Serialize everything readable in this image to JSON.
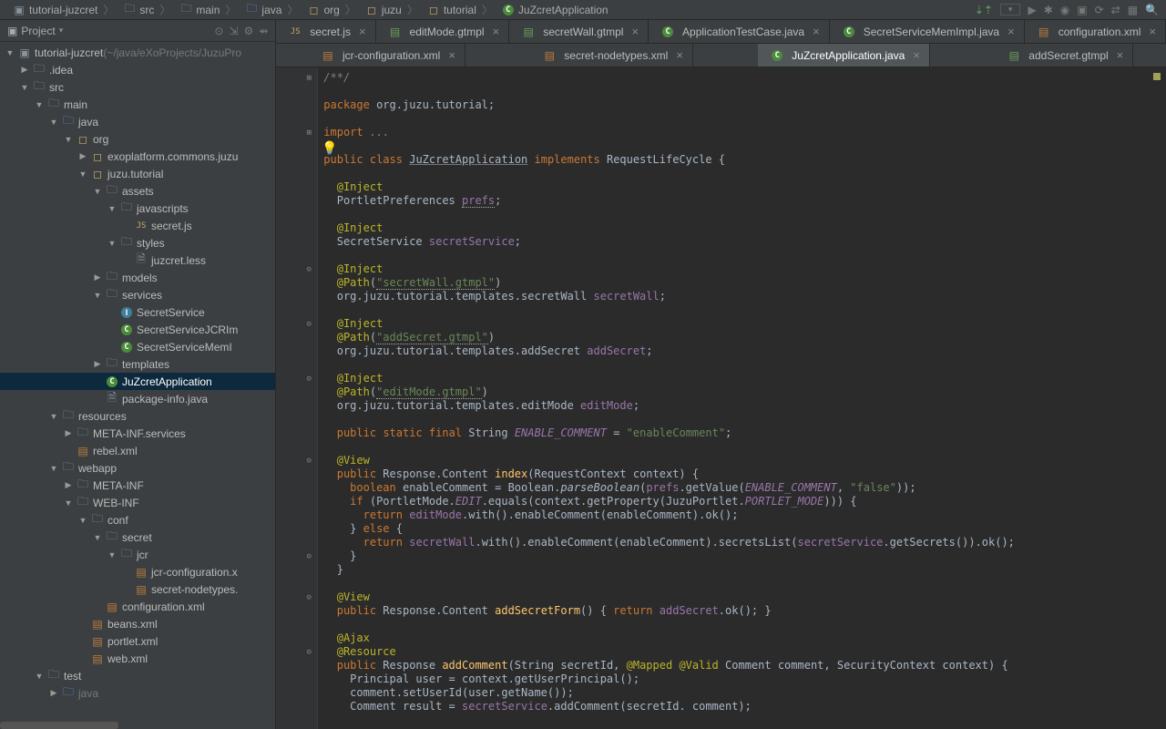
{
  "breadcrumb": {
    "items": [
      {
        "label": "tutorial-juzcret",
        "icon": "module"
      },
      {
        "label": "src",
        "icon": "folder"
      },
      {
        "label": "main",
        "icon": "folder"
      },
      {
        "label": "java",
        "icon": "folder-src"
      },
      {
        "label": "org",
        "icon": "pkg"
      },
      {
        "label": "juzu",
        "icon": "pkg"
      },
      {
        "label": "tutorial",
        "icon": "pkg"
      },
      {
        "label": "JuZcretApplication",
        "icon": "class"
      }
    ]
  },
  "sidebar": {
    "title": "Project",
    "root": {
      "label": "tutorial-juzcret",
      "path": "(~/java/eXoProjects/JuzuPro"
    }
  },
  "tree": [
    {
      "lvl": 0,
      "arrow": "▼",
      "icon": "module",
      "label": "tutorial-juzcret",
      "extra": " (~/java/eXoProjects/JuzuPro"
    },
    {
      "lvl": 1,
      "arrow": "▶",
      "icon": "folder",
      "label": ".idea"
    },
    {
      "lvl": 1,
      "arrow": "▼",
      "icon": "folder",
      "label": "src"
    },
    {
      "lvl": 2,
      "arrow": "▼",
      "icon": "folder",
      "label": "main"
    },
    {
      "lvl": 3,
      "arrow": "▼",
      "icon": "folder-src",
      "label": "java"
    },
    {
      "lvl": 4,
      "arrow": "▼",
      "icon": "pkg",
      "label": "org"
    },
    {
      "lvl": 5,
      "arrow": "▶",
      "icon": "pkg",
      "label": "exoplatform.commons.juzu"
    },
    {
      "lvl": 5,
      "arrow": "▼",
      "icon": "pkg",
      "label": "juzu.tutorial"
    },
    {
      "lvl": 6,
      "arrow": "▼",
      "icon": "folder",
      "label": "assets"
    },
    {
      "lvl": 7,
      "arrow": "▼",
      "icon": "folder",
      "label": "javascripts"
    },
    {
      "lvl": 8,
      "arrow": "",
      "icon": "js",
      "label": "secret.js"
    },
    {
      "lvl": 7,
      "arrow": "▼",
      "icon": "folder",
      "label": "styles"
    },
    {
      "lvl": 8,
      "arrow": "",
      "icon": "file",
      "label": "juzcret.less"
    },
    {
      "lvl": 6,
      "arrow": "▶",
      "icon": "folder",
      "label": "models"
    },
    {
      "lvl": 6,
      "arrow": "▼",
      "icon": "folder",
      "label": "services"
    },
    {
      "lvl": 7,
      "arrow": "",
      "icon": "iface",
      "label": "SecretService"
    },
    {
      "lvl": 7,
      "arrow": "",
      "icon": "class",
      "label": "SecretServiceJCRIm"
    },
    {
      "lvl": 7,
      "arrow": "",
      "icon": "class",
      "label": "SecretServiceMemI"
    },
    {
      "lvl": 6,
      "arrow": "▶",
      "icon": "folder",
      "label": "templates"
    },
    {
      "lvl": 6,
      "arrow": "",
      "icon": "class",
      "label": "JuZcretApplication",
      "sel": true
    },
    {
      "lvl": 6,
      "arrow": "",
      "icon": "file",
      "label": "package-info.java"
    },
    {
      "lvl": 3,
      "arrow": "▼",
      "icon": "folder",
      "label": "resources"
    },
    {
      "lvl": 4,
      "arrow": "▶",
      "icon": "folder",
      "label": "META-INF.services"
    },
    {
      "lvl": 4,
      "arrow": "",
      "icon": "xml",
      "label": "rebel.xml"
    },
    {
      "lvl": 3,
      "arrow": "▼",
      "icon": "folder",
      "label": "webapp"
    },
    {
      "lvl": 4,
      "arrow": "▶",
      "icon": "folder",
      "label": "META-INF"
    },
    {
      "lvl": 4,
      "arrow": "▼",
      "icon": "folder",
      "label": "WEB-INF"
    },
    {
      "lvl": 5,
      "arrow": "▼",
      "icon": "folder",
      "label": "conf"
    },
    {
      "lvl": 6,
      "arrow": "▼",
      "icon": "folder",
      "label": "secret"
    },
    {
      "lvl": 7,
      "arrow": "▼",
      "icon": "folder",
      "label": "jcr"
    },
    {
      "lvl": 8,
      "arrow": "",
      "icon": "xml",
      "label": "jcr-configuration.x"
    },
    {
      "lvl": 8,
      "arrow": "",
      "icon": "xml",
      "label": "secret-nodetypes."
    },
    {
      "lvl": 6,
      "arrow": "",
      "icon": "xml",
      "label": "configuration.xml"
    },
    {
      "lvl": 5,
      "arrow": "",
      "icon": "xml",
      "label": "beans.xml"
    },
    {
      "lvl": 5,
      "arrow": "",
      "icon": "xml",
      "label": "portlet.xml"
    },
    {
      "lvl": 5,
      "arrow": "",
      "icon": "xml",
      "label": "web.xml"
    },
    {
      "lvl": 2,
      "arrow": "▼",
      "icon": "folder",
      "label": "test"
    },
    {
      "lvl": 3,
      "arrow": "▶",
      "icon": "folder-src",
      "label": "java",
      "dim": true
    }
  ],
  "tabs_row1": [
    {
      "icon": "js",
      "label": "secret.js"
    },
    {
      "icon": "tmpl",
      "label": "editMode.gtmpl"
    },
    {
      "icon": "tmpl",
      "label": "secretWall.gtmpl"
    },
    {
      "icon": "class",
      "label": "ApplicationTestCase.java"
    },
    {
      "icon": "class",
      "label": "SecretServiceMemImpl.java"
    },
    {
      "icon": "xml",
      "label": "configuration.xml"
    }
  ],
  "tabs_row2": [
    {
      "icon": "xml",
      "label": "jcr-configuration.xml"
    },
    {
      "icon": "xml",
      "label": "secret-nodetypes.xml"
    },
    {
      "icon": "class",
      "label": "JuZcretApplication.java",
      "active": true
    },
    {
      "icon": "tmpl",
      "label": "addSecret.gtmpl"
    }
  ],
  "code": {
    "c0": "/**/",
    "c1": "package",
    "c2": " org.juzu.tutorial;",
    "c3": "import",
    "c4": " ...",
    "c5": "public",
    "c6": "class",
    "c7": "JuZcretApplication",
    "c8": "implements",
    "c9": " RequestLifeCycle {",
    "c10": "@Inject",
    "c11": "PortletPreferences ",
    "c12": "prefs",
    "c13": ";",
    "c14": "SecretService ",
    "c15": "secretService",
    "c16": "@Path",
    "c17": "\"secretWall.gtmpl\"",
    "c18": "org.juzu.tutorial.templates.secretWall ",
    "c19": "secretWall",
    "c20": "\"addSecret.gtmpl\"",
    "c21": "org.juzu.tutorial.templates.addSecret ",
    "c22": "addSecret",
    "c23": "\"editMode.gtmpl\"",
    "c24": "org.juzu.tutorial.templates.editMode ",
    "c25": "editMode",
    "c26": "static",
    "c27": "final",
    "c28": " String ",
    "c29": "ENABLE_COMMENT",
    "c30": " = ",
    "c31": "\"enableComment\"",
    "c32": "@View",
    "c33": " Response.Content ",
    "c34": "index",
    "c35": "(RequestContext context) {",
    "c36": "boolean",
    "c37": " enableComment = Boolean.",
    "c38": "parseBoolean",
    "c39": "(",
    "c40": "prefs",
    "c41": ".getValue(",
    "c42": ", ",
    "c43": "\"false\"",
    "c44": "));",
    "c45": "if",
    "c46": " (PortletMode.",
    "c47": "EDIT",
    "c48": ".equals(context.getProperty(JuzuPortlet.",
    "c49": "PORTLET_MODE",
    "c50": "))) {",
    "c51": "return",
    "c52": "editMode",
    "c53": ".with().enableComment(enableComment).ok();",
    "c54": "} ",
    "c55": "else",
    "c56": " {",
    "c57": "secretWall",
    "c58": ".with().enableComment(enableComment).secretsList(",
    "c59": "secretService",
    "c60": ".getSecrets()).ok();",
    "c61": "}",
    "c62": "addSecretForm",
    "c63": "() { ",
    "c64": "addSecret",
    "c65": ".ok(); }",
    "c66": "@Ajax",
    "c67": "@Resource",
    "c68": " Response ",
    "c69": "addComment",
    "c70": "(String secretId, ",
    "c71": "@Mapped",
    "c72": " ",
    "c73": "@Valid",
    "c74": " Comment comment, SecurityContext context) {",
    "c75": "Principal user = context.getUserPrincipal();",
    "c76": "comment.setUserId(user.getName());",
    "c77": "Comment result = ",
    "c78": ".addComment(secretId. comment);"
  }
}
